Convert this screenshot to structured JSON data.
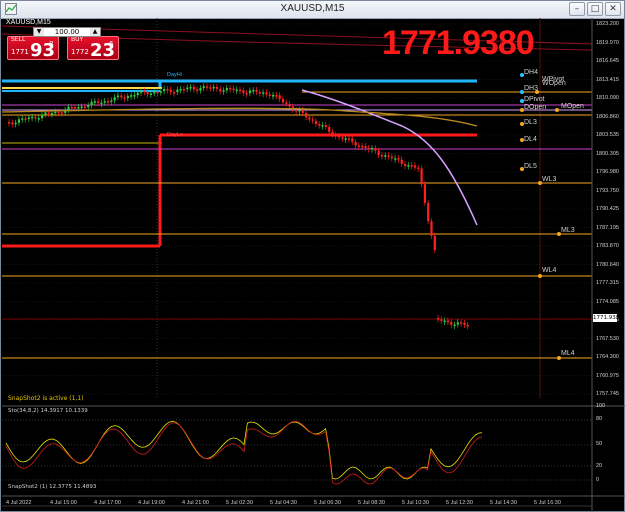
{
  "window": {
    "title": "XAUUSD,M15",
    "buttons": [
      "minimize",
      "maximize",
      "close"
    ]
  },
  "chart": {
    "symbol_label": "XAUUSD,M15",
    "big_price": "1771.9380",
    "current_price": "1771.938",
    "trade_panel": {
      "sell_label": "SELL",
      "buy_label": "BUY",
      "lot": "100.00",
      "sell_small": "1771",
      "sell_big": "93",
      "sell_sup": "8",
      "buy_small": "1772",
      "buy_big": "23",
      "buy_sup": "6"
    },
    "price_axis": [
      "1823.200",
      "1819.970",
      "1816.645",
      "1813.415",
      "1810.090",
      "1806.860",
      "1803.535",
      "1800.305",
      "1796.980",
      "1793.750",
      "1790.425",
      "1787.195",
      "1783.870",
      "1780.640",
      "1777.315",
      "1774.085",
      "1770.855",
      "1767.530",
      "1764.300",
      "1760.975",
      "1757.745"
    ],
    "time_axis": [
      "4 Jul 2022",
      "4 Jul 15:00",
      "4 Jul 17:00",
      "4 Jul 19:00",
      "4 Jul 21:00",
      "5 Jul 02:30",
      "5 Jul 04:30",
      "5 Jul 06:30",
      "5 Jul 08:30",
      "5 Jul 10:30",
      "5 Jul 12:30",
      "5 Jul 14:30",
      "5 Jul 16:30"
    ],
    "day_labels": {
      "day_hi": "DayHi",
      "day_lo": "DayLo"
    },
    "levels": [
      {
        "label": "DH4",
        "color": "#cfcfcf"
      },
      {
        "label": "WPivot",
        "color": "#cfcfcf"
      },
      {
        "label": "DH3",
        "color": "#cfcfcf"
      },
      {
        "label": "WOpen",
        "color": "#cfcfcf"
      },
      {
        "label": "DPivot",
        "color": "#cfcfcf"
      },
      {
        "label": "DOpen",
        "color": "#cfcfcf"
      },
      {
        "label": "MOpen",
        "color": "#cfcfcf"
      },
      {
        "label": "DL3",
        "color": "#cfcfcf"
      },
      {
        "label": "DL4",
        "color": "#cfcfcf"
      },
      {
        "label": "DL5",
        "color": "#cfcfcf"
      },
      {
        "label": "WL3",
        "color": "#cfcfcf"
      },
      {
        "label": "ML3",
        "color": "#cfcfcf"
      },
      {
        "label": "WL4",
        "color": "#cfcfcf"
      },
      {
        "label": "ML4",
        "color": "#cfcfcf"
      }
    ],
    "snapshot_text": "SnapShot2 is active (1,1)",
    "indicator_label": "Sto(34,8,2) 14.3917 10.1339",
    "indicator_axis": [
      "100",
      "80",
      "50",
      "20",
      "0"
    ],
    "indicator2_label": "SnapShot2 (1) 12.3775 11.4893",
    "colors": {
      "bull": "#2ecc40",
      "bear": "#ff2020",
      "day_hi": "#1fb6ff",
      "day_lo": "#ff1a1a",
      "level": "#f5a623"
    }
  }
}
